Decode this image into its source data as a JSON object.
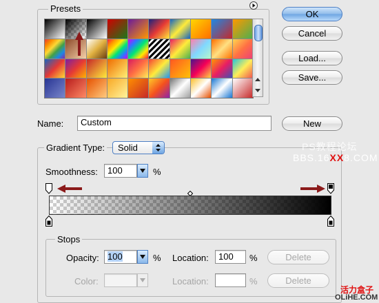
{
  "presets": {
    "legend": "Presets",
    "swatches": [
      "linear-gradient(135deg,#000,#fff)",
      "linear-gradient(135deg,#000 0%,rgba(0,0,0,0) 100%),repeating-conic-gradient(#ccc 0 25%,#fff 0 50%) 0 0/8px 8px",
      "linear-gradient(135deg,#000,#fff)",
      "linear-gradient(135deg,#d00000,#1a7a1a)",
      "linear-gradient(135deg,#6a1b9a,#ff9800)",
      "linear-gradient(135deg,#1a237e,#e53935,#ffeb3b)",
      "linear-gradient(135deg,#1565c0,#ffeb3b,#1565c0)",
      "linear-gradient(135deg,#ffd600,#ff6d00)",
      "linear-gradient(135deg,#1e88e5,#c62828)",
      "linear-gradient(135deg,#ff9800,#4caf50)",
      "linear-gradient(135deg,#e53935,#fb8c00,#fdd835,#43a047,#1e88e5,#8e24aa)",
      "linear-gradient(135deg,#8d4a2a,#f5d0a9)",
      "linear-gradient(135deg,#ffffff,#e0b040,#6a3d12)",
      "linear-gradient(135deg,#ff1744,#ff9100,#ffea00,#00e676,#2979ff,#d500f9)",
      "linear-gradient(135deg,#d500f9,#2979ff,#00e676,#ffea00,#ff1744),repeating-conic-gradient(#ccc 0 25%,#fff 0 50%) 0 0/8px 8px",
      "repeating-linear-gradient(135deg,#000 0 3px,#fff 3px 6px)",
      "linear-gradient(135deg,#e91e63,#ffeb3b,#4caf50)",
      "linear-gradient(135deg,#ff80ab,#80d8ff,#b9f6ca)",
      "linear-gradient(135deg,#ff6f00,#ffe082,#ff6f00)",
      "linear-gradient(135deg,#ffd54f,#ff7043,#ec407a)",
      "linear-gradient(135deg,#1565c0,#e53935,#fdd835)",
      "linear-gradient(135deg,#7b1fa2,#e53935,#ffb300)",
      "linear-gradient(135deg,#c62828,#ffeb3b)",
      "linear-gradient(135deg,#ef6c00,#fff176)",
      "linear-gradient(135deg,#d81b60,#ff7043,#ffee58)",
      "linear-gradient(135deg,#f44336,#ffeb3b,#2196f3)",
      "linear-gradient(135deg,#ff5722,#ffc107)",
      "linear-gradient(135deg,#4a148c,#f50057,#ffd740)",
      "linear-gradient(135deg,#ff9800,#e91e63,#3f51b5)",
      "linear-gradient(135deg,#26c6da,#ffee58,#ef5350)",
      "linear-gradient(135deg,#283593,#7986cb)",
      "linear-gradient(135deg,#b71c1c,#ff8a65)",
      "linear-gradient(135deg,#e65100,#ffcc80)",
      "linear-gradient(135deg,#f9a825,#fff59d)",
      "linear-gradient(135deg,#ff8f00,#c62828)",
      "linear-gradient(135deg,#ffca28,#f4511e,#8e24aa)",
      "linear-gradient(135deg,#757575,#ffffff,#9e9e9e)",
      "linear-gradient(135deg,#fbc02d,#ffffff,#e65100)",
      "linear-gradient(135deg,#1976d2,#ffffff,#1976d2)",
      "linear-gradient(135deg,#ffffff,#c62828)"
    ]
  },
  "buttons": {
    "ok": "OK",
    "cancel": "Cancel",
    "load": "Load...",
    "save": "Save...",
    "new": "New"
  },
  "name_field": {
    "label": "Name:",
    "value": "Custom"
  },
  "gradient_type": {
    "label": "Gradient Type:",
    "value": "Solid"
  },
  "smoothness": {
    "label": "Smoothness:",
    "value": "100",
    "unit": "%"
  },
  "stops": {
    "legend": "Stops",
    "opacity_label": "Opacity:",
    "opacity_value": "100",
    "opacity_unit": "%",
    "opacity_location_label": "Location:",
    "opacity_location_value": "100",
    "opacity_location_unit": "%",
    "opacity_delete": "Delete",
    "color_label": "Color:",
    "color_location_label": "Location:",
    "color_location_value": "",
    "color_location_unit": "%",
    "color_delete": "Delete"
  },
  "watermark": {
    "line1": "PS教程论坛",
    "line2_prefix": "BBS.16",
    "line2_xx": "XX",
    "line2_suffix": "8.COM",
    "brand_cn": "活力盒子",
    "brand_url": "OLiHE.COM"
  },
  "colors": {
    "accent": "#6ea5e2",
    "arrow": "#8b1a1a",
    "watermark_red": "#e01010"
  },
  "icons": {
    "flyout": "circle-triangle-right-icon",
    "dropdown": "chevron-down-icon",
    "stepper": "up-down-arrows-icon"
  }
}
